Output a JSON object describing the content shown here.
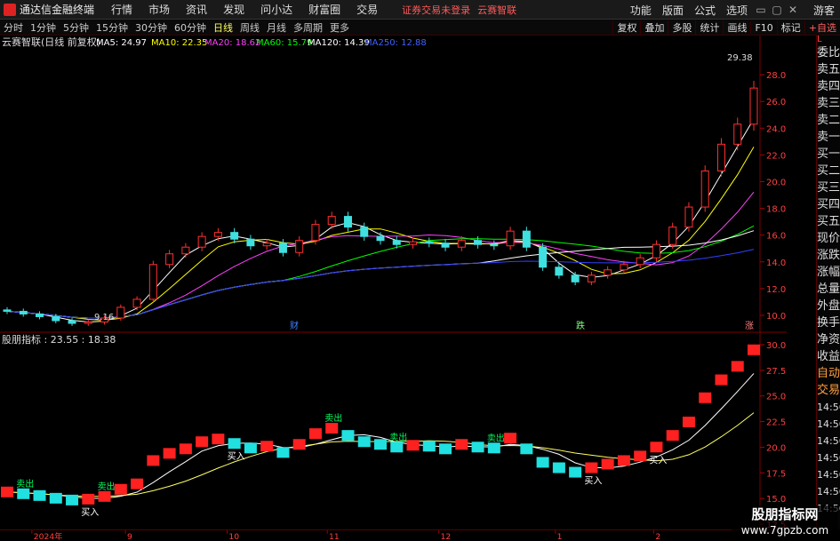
{
  "app": {
    "title": "通达信金融终端",
    "menu": [
      "行情",
      "市场",
      "资讯",
      "发现",
      "问小达",
      "财富圈",
      "交易"
    ],
    "notice": "证券交易未登录",
    "notice2": "云赛智联",
    "right_menu": [
      "功能",
      "版面",
      "公式",
      "选项"
    ],
    "guest": "游客"
  },
  "toolbar": {
    "periods": [
      "分时",
      "1分钟",
      "5分钟",
      "15分钟",
      "30分钟",
      "60分钟",
      "日线",
      "周线",
      "月线",
      "多周期",
      "更多"
    ],
    "active_period": "日线",
    "tools": [
      "复权",
      "叠加",
      "多股",
      "统计",
      "画线",
      "F10",
      "标记",
      "+自选"
    ]
  },
  "main_panel": {
    "title": "云赛智联(日线 前复权)",
    "ma": [
      {
        "label": "MA5: 24.97",
        "color": "#ffffff"
      },
      {
        "label": "MA10: 22.35",
        "color": "#ffff00"
      },
      {
        "label": "MA20: 18.62",
        "color": "#ff40ff"
      },
      {
        "label": "MA60: 15.79",
        "color": "#00ff00"
      },
      {
        "label": "MA120: 14.39",
        "color": "#ffffff"
      },
      {
        "label": "MA250: 12.88",
        "color": "#4040ff"
      }
    ],
    "y_ticks": [
      "28.00",
      "26.00",
      "24.00",
      "22.00",
      "20.00",
      "18.00",
      "16.00",
      "14.00",
      "12.00",
      "10.00"
    ],
    "high_label": "29.38",
    "low_label": "9.16",
    "markers": [
      {
        "text": "财",
        "color": "#4080ff"
      },
      {
        "text": "跌",
        "color": "#80ff80"
      },
      {
        "text": "涨",
        "color": "#ff8080"
      }
    ]
  },
  "indicator_panel": {
    "title": "股朋指标 : 23.55 : 18.38",
    "y_ticks": [
      "30.00",
      "27.50",
      "25.00",
      "22.50",
      "20.00",
      "17.50",
      "15.00",
      "12.50"
    ],
    "signals": [
      "卖出",
      "买入",
      "卖出",
      "买入",
      "卖出",
      "卖出",
      "卖出",
      "买入",
      "买入"
    ]
  },
  "x_axis": {
    "labels": [
      "2024年",
      "9",
      "10",
      "11",
      "12",
      "1",
      "2"
    ]
  },
  "right_panel": {
    "items": [
      "委比",
      "卖五",
      "卖四",
      "卖三",
      "卖二",
      "卖一",
      "买一",
      "买二",
      "买三",
      "买四",
      "买五",
      "现价",
      "涨跌",
      "涨幅",
      "总量",
      "外盘",
      "换手",
      "净资",
      "收益"
    ],
    "top_label": "L",
    "auto_trade_1": "自动",
    "auto_trade_2": "交易",
    "times": [
      "14:56",
      "14:56",
      "14:56",
      "14:56",
      "14:56",
      "14:56",
      "14:56"
    ]
  },
  "watermark": {
    "line1": "股朋指标网",
    "line2": "www.7gpzb.com"
  },
  "chart_data": {
    "type": "candlestick",
    "x": [
      "2024-08",
      "2024-09",
      "2024-10",
      "2024-11",
      "2024-12",
      "2025-01",
      "2025-02"
    ],
    "close": [
      10.3,
      10.1,
      9.9,
      9.6,
      9.4,
      9.5,
      9.8,
      10.6,
      11.2,
      13.8,
      14.6,
      15.1,
      15.9,
      16.2,
      15.7,
      15.2,
      15.4,
      14.7,
      15.6,
      16.8,
      17.4,
      16.6,
      15.9,
      15.6,
      15.3,
      15.5,
      15.4,
      15.1,
      15.6,
      15.3,
      15.2,
      16.3,
      15.1,
      13.6,
      13.0,
      12.5,
      13.0,
      13.4,
      13.8,
      14.3,
      15.3,
      16.6,
      18.1,
      20.8,
      22.8,
      24.3,
      27.0
    ],
    "ma5_last": 24.97,
    "ma10_last": 22.35,
    "ma20_last": 18.62,
    "ma60_last": 15.79,
    "ma120_last": 14.39,
    "ma250_last": 12.88,
    "high": 29.38,
    "low": 9.16,
    "ylim": [
      9.0,
      30.0
    ],
    "indicator": {
      "name": "股朋指标",
      "value1": 23.55,
      "value2": 18.38,
      "ylim": [
        12.5,
        30.0
      ]
    }
  }
}
